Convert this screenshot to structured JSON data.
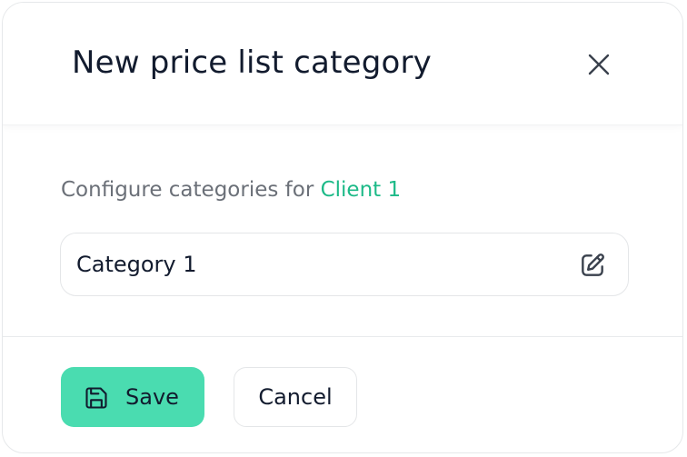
{
  "dialog": {
    "title": "New price list category",
    "close_icon": "close-icon"
  },
  "body": {
    "subtitle_prefix": "Configure categories for",
    "client_name": "Client 1",
    "category_field": {
      "value": "Category 1",
      "edit_icon": "edit-icon"
    }
  },
  "footer": {
    "save_label": "Save",
    "save_icon": "save-icon",
    "cancel_label": "Cancel"
  },
  "colors": {
    "accent": "#4adcb0",
    "link": "#1dba88",
    "text": "#121b2e",
    "muted": "#6b7078"
  }
}
